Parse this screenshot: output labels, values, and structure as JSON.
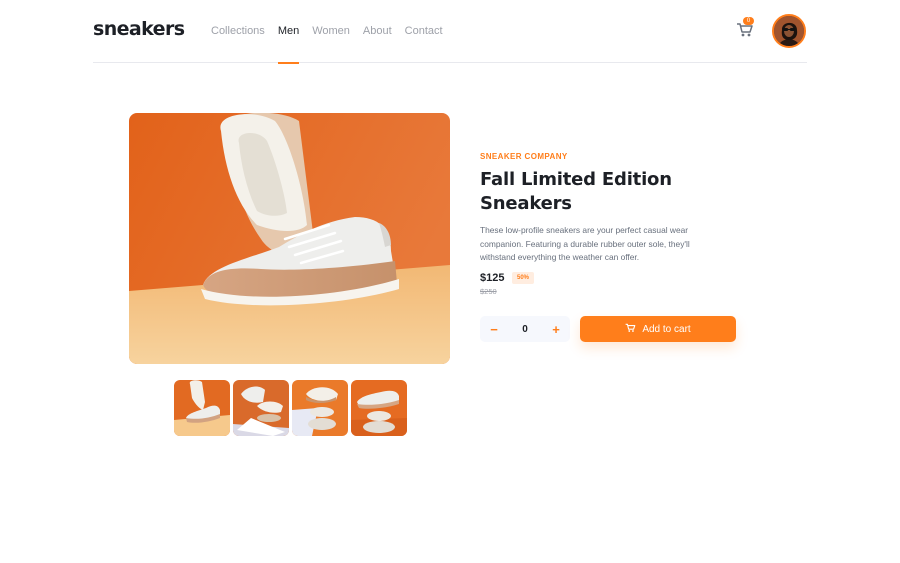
{
  "brand": {
    "logo": "sneakers"
  },
  "nav": {
    "items": [
      {
        "label": "Collections",
        "active": false
      },
      {
        "label": "Men",
        "active": true
      },
      {
        "label": "Women",
        "active": false
      },
      {
        "label": "About",
        "active": false
      },
      {
        "label": "Contact",
        "active": false
      }
    ]
  },
  "cart": {
    "icon": "cart-icon",
    "count": "0"
  },
  "avatar": {
    "icon": "user-avatar"
  },
  "product": {
    "company": "SNEAKER COMPANY",
    "title": "Fall Limited Edition Sneakers",
    "description": "These low-profile sneakers are your perfect casual wear companion. Featuring a durable rubber outer sole, they'll withstand everything the weather can offer.",
    "price": "$125",
    "discount": "50%",
    "old_price": "$250"
  },
  "quantity": {
    "minus": "−",
    "value": "0",
    "plus": "+"
  },
  "actions": {
    "add_to_cart": "Add to cart"
  },
  "colors": {
    "accent": "#ff7e1b",
    "dark": "#1d2026",
    "muted": "#68707d",
    "light": "#f6f8fd"
  }
}
